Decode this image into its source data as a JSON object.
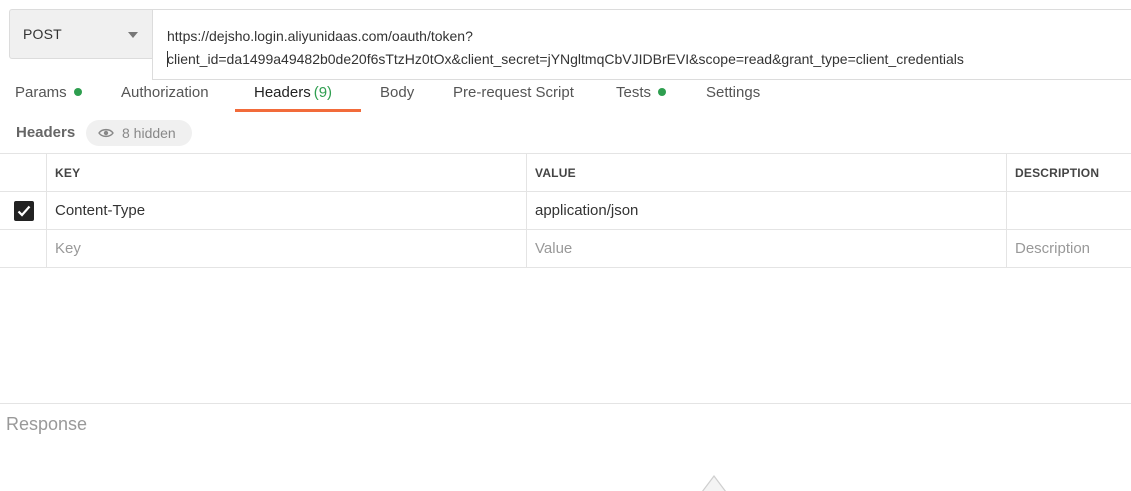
{
  "request": {
    "method": "POST",
    "url_line1": "https://dejsho.login.aliyunidaas.com/oauth/token?",
    "url_line2": "client_id=da1499a49482b0de20f6sTtzHz0tOx&client_secret=jYNgltmqCbVJIDBrEVI&scope=read&grant_type=client_credentials"
  },
  "tabs": [
    {
      "label": "Params",
      "dot": true
    },
    {
      "label": "Authorization"
    },
    {
      "label": "Headers",
      "count": "(9)",
      "active": true
    },
    {
      "label": "Body"
    },
    {
      "label": "Pre-request Script"
    },
    {
      "label": "Tests",
      "dot": true
    },
    {
      "label": "Settings"
    }
  ],
  "headers_section": {
    "title": "Headers",
    "hidden_label": "8 hidden"
  },
  "table": {
    "columns": [
      "KEY",
      "VALUE",
      "DESCRIPTION"
    ],
    "rows": [
      {
        "checked": true,
        "key": "Content-Type",
        "value": "application/json",
        "description": ""
      }
    ],
    "placeholders": {
      "key": "Key",
      "value": "Value",
      "description": "Description"
    }
  },
  "response": {
    "title": "Response"
  },
  "colors": {
    "accent": "#f26b3a",
    "dot": "#2e9e4f"
  }
}
